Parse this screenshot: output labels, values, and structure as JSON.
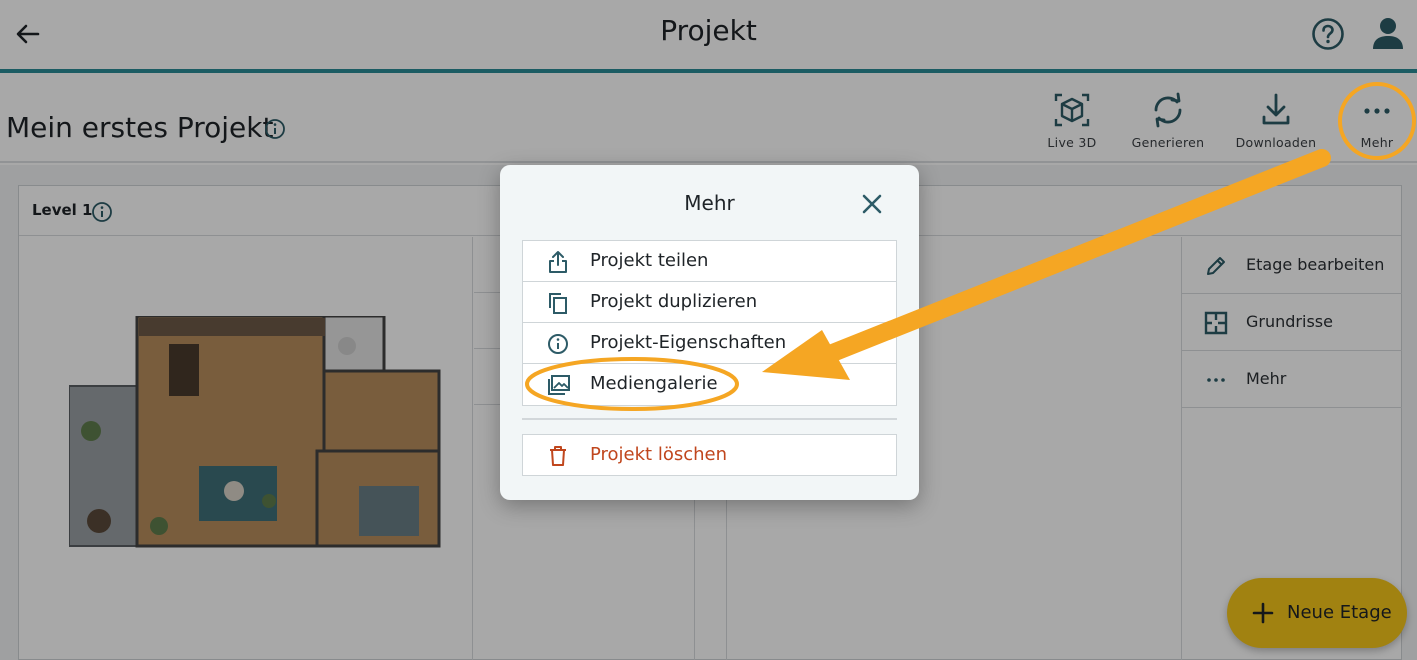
{
  "app_bar": {
    "title": "Projekt",
    "back_icon": "arrow-left-icon",
    "help_icon": "help-circle-icon",
    "user_icon": "user-icon"
  },
  "project": {
    "title": "Mein erstes Projekt"
  },
  "toolbar": {
    "live3d_label": "Live 3D",
    "generate_label": "Generieren",
    "download_label": "Downloaden",
    "more_label": "Mehr"
  },
  "level": {
    "title": "Level 1"
  },
  "right_panel": {
    "items": [
      {
        "label": "Etage bearbeiten",
        "icon": "pencil-icon"
      },
      {
        "label": "Grundrisse",
        "icon": "floorplan-icon"
      },
      {
        "label": "Mehr",
        "icon": "more-horizontal-icon"
      }
    ]
  },
  "fab": {
    "label": "Neue Etage"
  },
  "dialog": {
    "title": "Mehr",
    "items": [
      {
        "label": "Projekt teilen",
        "icon": "share-icon"
      },
      {
        "label": "Projekt duplizieren",
        "icon": "copy-icon"
      },
      {
        "label": "Projekt-Eigenschaften",
        "icon": "info-icon"
      },
      {
        "label": "Mediengalerie",
        "icon": "gallery-icon"
      }
    ],
    "delete_label": "Projekt löschen"
  },
  "colors": {
    "accent_teal": "#2a8c96",
    "icon_teal": "#2d5b67",
    "annotation_orange": "#f5a623",
    "danger": "#c0461d",
    "fab_yellow": "#f5c51a"
  }
}
